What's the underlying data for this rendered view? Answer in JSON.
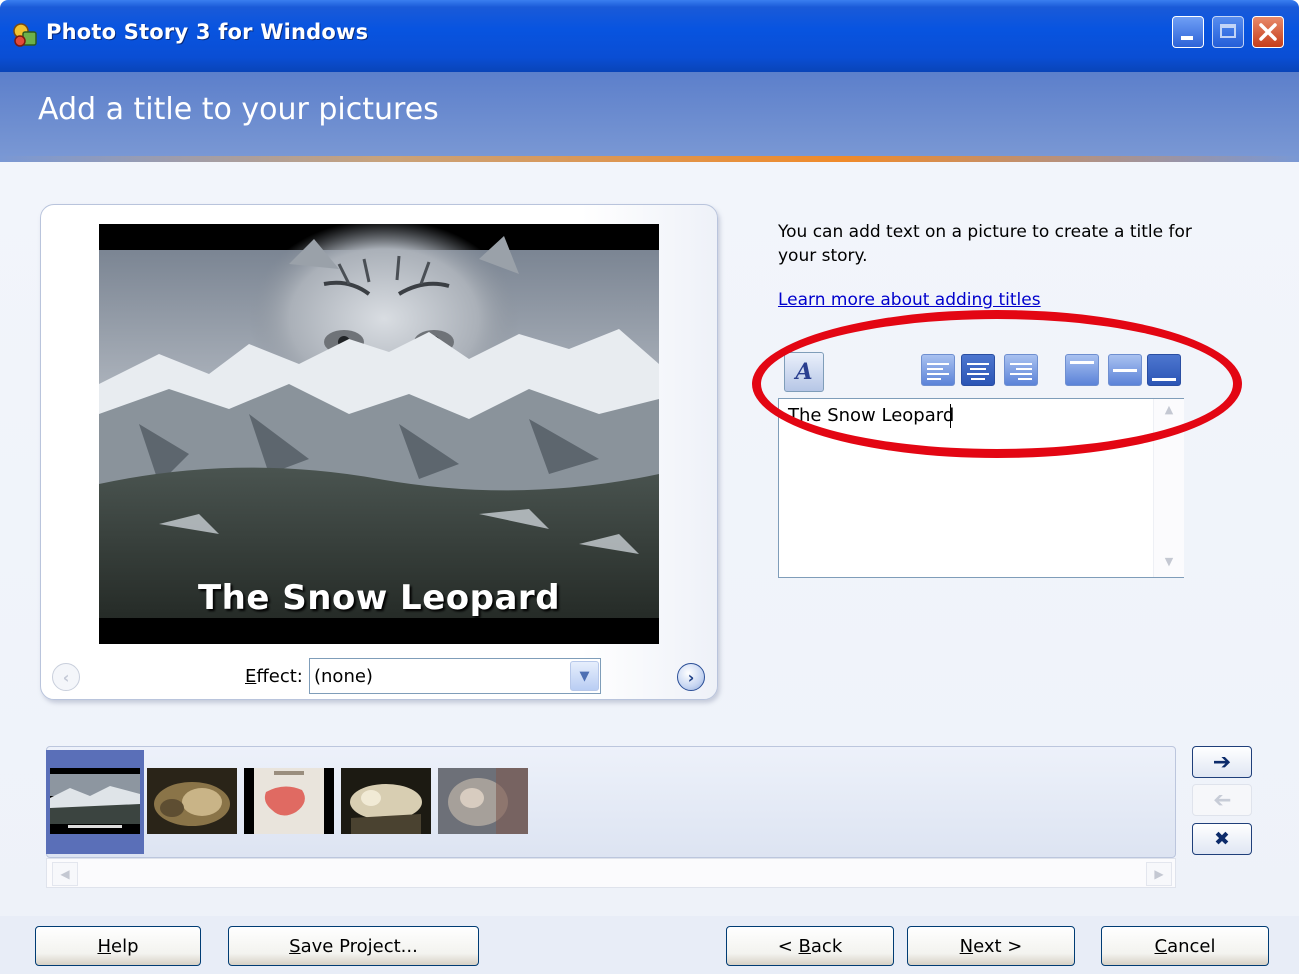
{
  "window": {
    "title": "Photo Story 3 for Windows"
  },
  "header": {
    "heading": "Add a title to your pictures"
  },
  "preview": {
    "caption": "The Snow Leopard",
    "effect_label": "Effect:",
    "effect_label_mnemonic": "E",
    "effect_label_rest": "ffect:",
    "effect_value": "(none)"
  },
  "instructions": {
    "text": "You can add text on a picture to create a title for your story.",
    "link": "Learn more about adding titles"
  },
  "title_toolbar": {
    "font_icon_glyph": "A",
    "horizontal_alignment": "center",
    "vertical_alignment": "bottom"
  },
  "title_text": {
    "value": "The Snow Leopard"
  },
  "filmstrip": {
    "selected_index": 0,
    "thumbnail_count": 5
  },
  "buttons": {
    "help": {
      "mnemonic": "H",
      "rest": "elp"
    },
    "save_project": {
      "mnemonic": "S",
      "rest": "ave Project..."
    },
    "back": {
      "prefix": "< ",
      "mnemonic": "B",
      "rest": "ack"
    },
    "next": {
      "mnemonic": "N",
      "rest": "ext >"
    },
    "cancel": {
      "mnemonic": "C",
      "rest": "ancel"
    }
  },
  "colors": {
    "titlebar": "#0a4ed4",
    "header": "#6e8ed0",
    "highlight": "#e30613",
    "link": "#0000cc",
    "selected_thumb": "#5a6fb8"
  }
}
